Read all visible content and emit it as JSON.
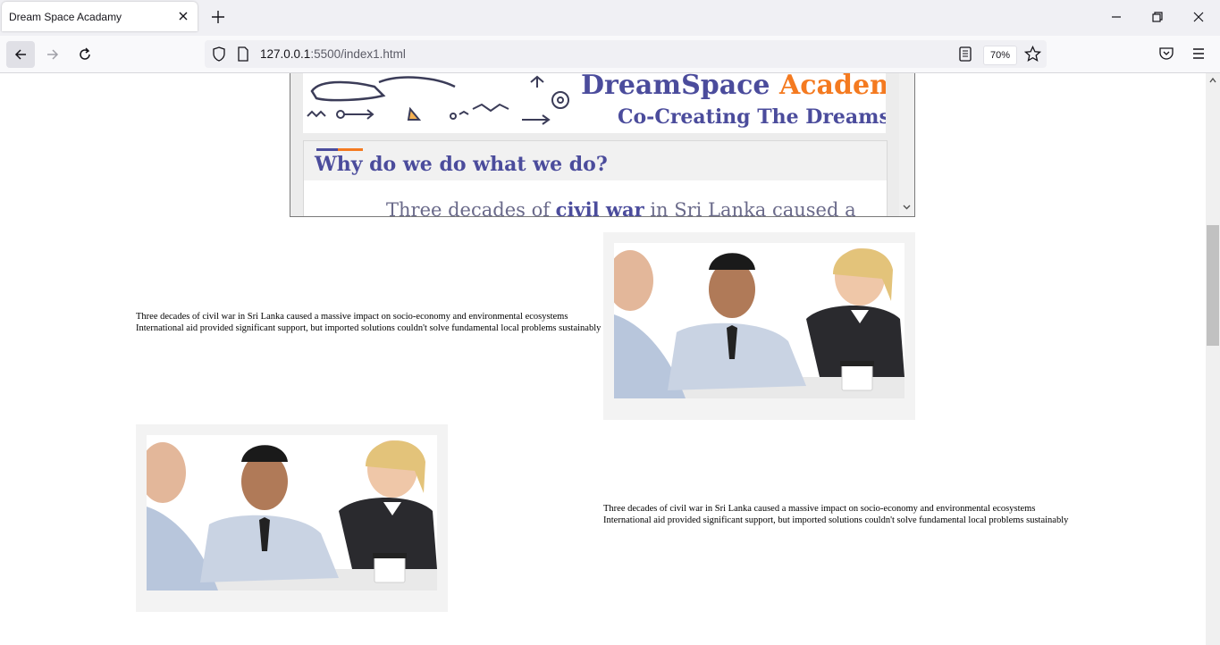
{
  "browser": {
    "tab_title": "Dream Space Acadamy",
    "url_host": "127.0.0.1",
    "url_rest": ":5500/index1.html",
    "zoom": "70%"
  },
  "icons": [
    "close-icon",
    "plus-icon",
    "minimize-icon",
    "restore-icon",
    "window-close-icon",
    "back-arrow-icon",
    "forward-arrow-icon",
    "reload-icon",
    "shield-icon",
    "page-icon",
    "reader-view-icon",
    "star-icon",
    "pocket-icon",
    "menu-icon",
    "chevron-down-icon",
    "chevron-up-icon"
  ],
  "embed": {
    "brand_main": "DreamSpace",
    "brand_accent": "Academy",
    "tagline": "Co-Creating The Dreams",
    "section_title": "Why do we do what we do?",
    "preview_before": "Three decades of ",
    "preview_bold": "civil war",
    "preview_after": " in Sri Lanka caused a"
  },
  "rows": [
    {
      "text_line1": "Three decades of civil war in Sri Lanka caused a massive impact on socio-economy and environmental ecosystems",
      "text_line2": "International aid provided significant support, but imported solutions couldn't solve fundamental local problems sustainably"
    },
    {
      "text_line1": "Three decades of civil war in Sri Lanka caused a massive impact on socio-economy and environmental ecosystems",
      "text_line2": "International aid provided significant support, but imported solutions couldn't solve fundamental local problems sustainably"
    }
  ],
  "colors": {
    "brand_purple": "#4b4c9c",
    "brand_orange": "#f47a20"
  }
}
